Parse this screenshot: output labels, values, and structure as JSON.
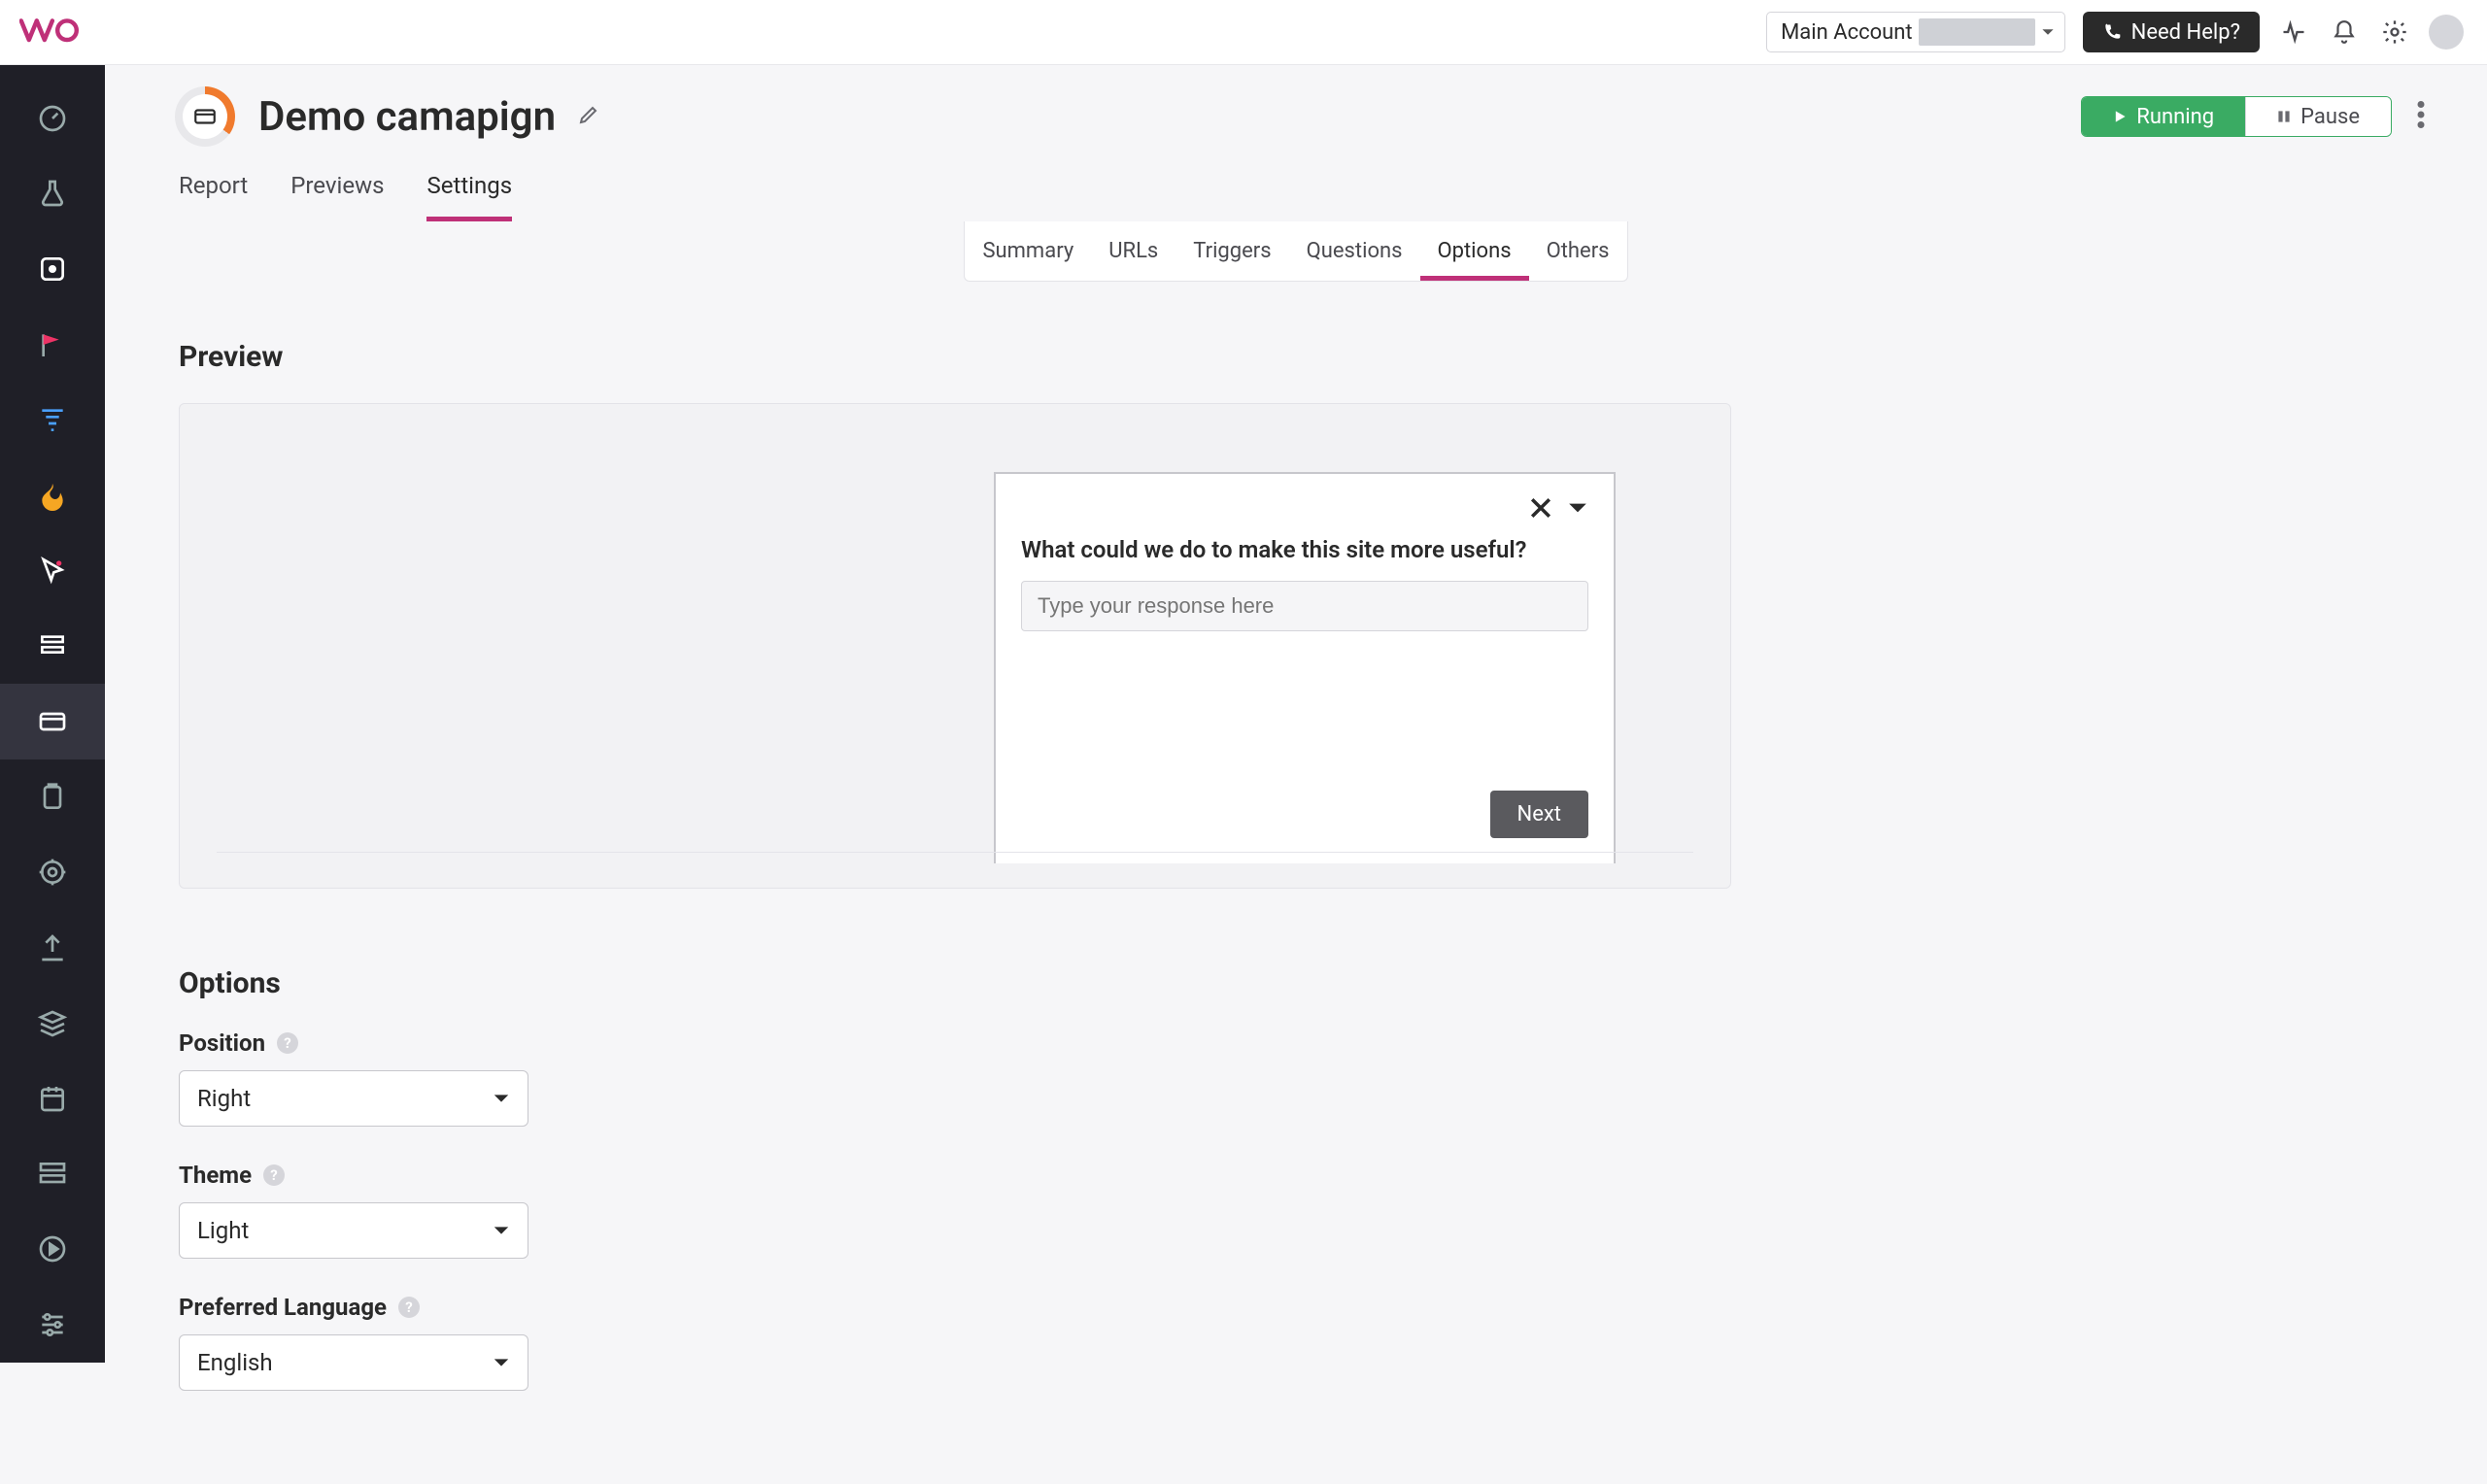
{
  "topbar": {
    "account_label": "Main Account",
    "need_help": "Need Help?"
  },
  "campaign": {
    "title": "Demo camapign"
  },
  "status": {
    "running": "Running",
    "pause": "Pause"
  },
  "tabs": {
    "primary": [
      "Report",
      "Previews",
      "Settings"
    ],
    "primary_active": 2,
    "secondary": [
      "Summary",
      "URLs",
      "Triggers",
      "Questions",
      "Options",
      "Others"
    ],
    "secondary_active": 4
  },
  "preview": {
    "heading": "Preview",
    "survey": {
      "question": "What could we do to make this site more useful?",
      "placeholder": "Type your response here",
      "next": "Next"
    }
  },
  "options": {
    "heading": "Options",
    "position": {
      "label": "Position",
      "value": "Right"
    },
    "theme": {
      "label": "Theme",
      "value": "Light"
    },
    "language": {
      "label": "Preferred Language",
      "value": "English"
    }
  },
  "sidebar": {
    "items": [
      "dashboard",
      "testing",
      "app",
      "goals",
      "funnels",
      "heatmaps",
      "recordings",
      "forms",
      "surveys",
      "scheduler",
      "targeting",
      "uploads",
      "stack",
      "calendar",
      "cms",
      "tutorials",
      "settings"
    ],
    "active": 8
  }
}
